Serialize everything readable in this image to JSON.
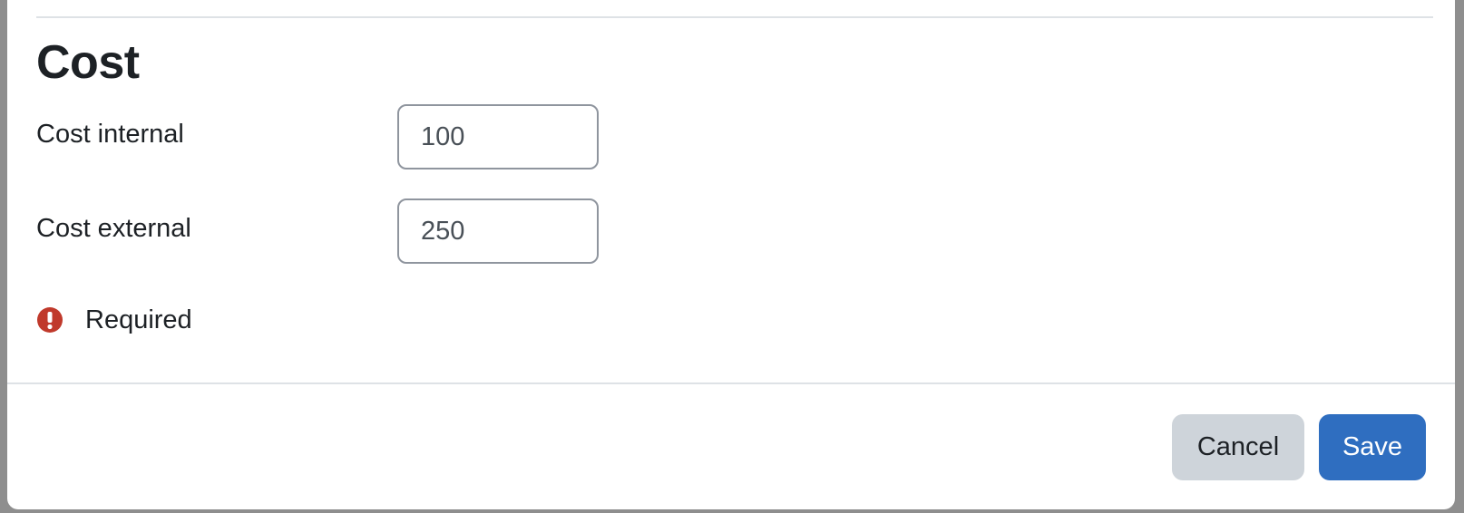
{
  "section": {
    "title": "Cost"
  },
  "fields": {
    "cost_internal": {
      "label": "Cost internal",
      "value": "100"
    },
    "cost_external": {
      "label": "Cost external",
      "value": "250"
    }
  },
  "required": {
    "icon": "exclamation-circle-icon",
    "text": "Required",
    "color": "#c0392b"
  },
  "footer": {
    "cancel_label": "Cancel",
    "save_label": "Save",
    "save_color": "#2f6ec0"
  }
}
